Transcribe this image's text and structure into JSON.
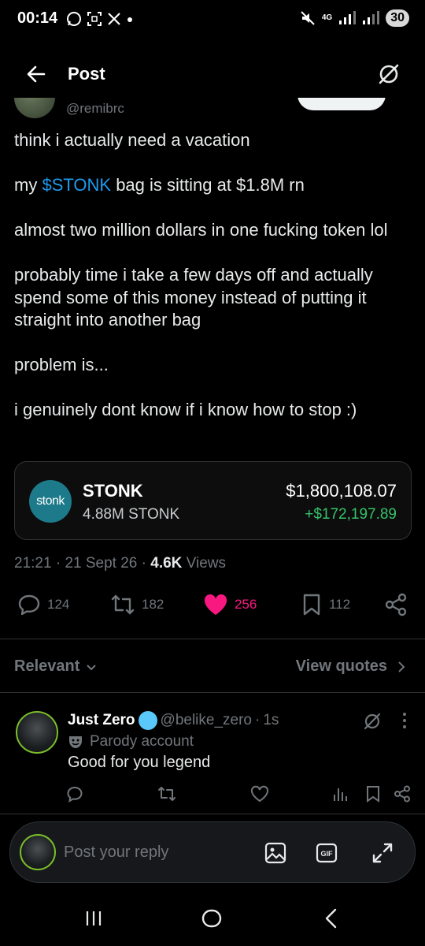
{
  "status_bar": {
    "time": "00:14",
    "network": "4G",
    "battery": "30"
  },
  "header": {
    "title": "Post"
  },
  "author": {
    "handle": "@remibrc"
  },
  "tweet": {
    "p1": "think i actually need a vacation",
    "p2_pre": "my ",
    "p2_cashtag": "$STONK",
    "p2_post": " bag is sitting at $1.8M rn",
    "p3": "almost two million dollars in one fucking token lol",
    "p4": "probably time i take a few days off and actually spend some of this money instead of putting it straight into another bag",
    "p5": "problem is...",
    "p6": "i genuinely dont know if i know how to stop :)"
  },
  "token_card": {
    "logo_text": "stonk",
    "name": "STONK",
    "amount": "4.88M STONK",
    "value": "$1,800,108.07",
    "change": "+$172,197.89",
    "change_color": "#35c46a",
    "logo_color": "#1c7a8a"
  },
  "meta": {
    "time": "21:21",
    "date": "21 Sept 26",
    "views_count": "4.6K",
    "views_label": "Views"
  },
  "actions": {
    "replies": "124",
    "reposts": "182",
    "likes": "256",
    "bookmarks": "112",
    "like_color": "#f91880"
  },
  "replies_filter": {
    "sort_label": "Relevant",
    "quotes_label": "View quotes"
  },
  "reply": {
    "name": "Just Zero",
    "handle": "@belike_zero",
    "separator": "·",
    "time": "1s",
    "parody_label": "Parody account",
    "text": "Good for you legend"
  },
  "compose": {
    "placeholder": "Post your reply"
  }
}
